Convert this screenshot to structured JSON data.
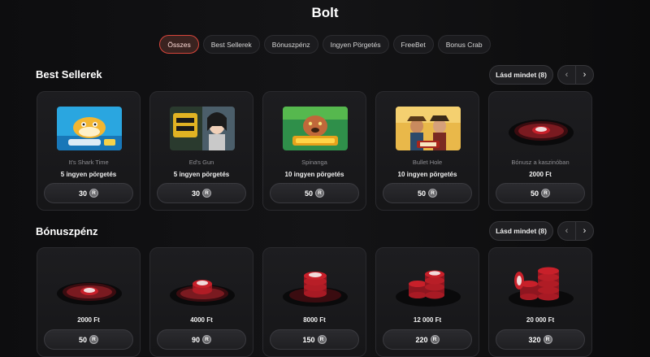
{
  "page": {
    "title": "Bolt"
  },
  "tabs": [
    {
      "label": "Összes",
      "active": true
    },
    {
      "label": "Best Sellerek",
      "active": false
    },
    {
      "label": "Bónuszpénz",
      "active": false
    },
    {
      "label": "Ingyen Pörgetés",
      "active": false
    },
    {
      "label": "FreeBet",
      "active": false
    },
    {
      "label": "Bonus Crab",
      "active": false
    }
  ],
  "sections": [
    {
      "title": "Best Sellerek",
      "see_all": "Lásd mindet (8)",
      "cards": [
        {
          "name": "It's Shark Time",
          "sub": "5 ingyen pörgetés",
          "price": "30",
          "image": "shark-time-game-thumbnail"
        },
        {
          "name": "Ed's Gun",
          "sub": "5 ingyen pörgetés",
          "price": "30",
          "image": "eds-gun-game-thumbnail"
        },
        {
          "name": "Spinanga",
          "sub": "10 ingyen pörgetés",
          "price": "50",
          "image": "spinanga-game-thumbnail"
        },
        {
          "name": "Bullet Hole",
          "sub": "10 ingyen pörgetés",
          "price": "50",
          "image": "bullet-hole-game-thumbnail"
        },
        {
          "name": "Bónusz a kaszinóban",
          "sub": "2000 Ft",
          "price": "50",
          "image": "casino-chip-single"
        }
      ]
    },
    {
      "title": "Bónuszpénz",
      "see_all": "Lásd mindet (8)",
      "cards": [
        {
          "sub": "2000 Ft",
          "price": "50",
          "image": "casino-chip-single"
        },
        {
          "sub": "4000 Ft",
          "price": "90",
          "image": "casino-chip-double"
        },
        {
          "sub": "8000 Ft",
          "price": "150",
          "image": "casino-chip-stack"
        },
        {
          "sub": "12 000 Ft",
          "price": "220",
          "image": "casino-chip-stack-large"
        },
        {
          "sub": "20 000 Ft",
          "price": "320",
          "image": "casino-chip-tower"
        }
      ]
    }
  ],
  "coin": {
    "glyph": "R"
  },
  "nav": {
    "prev": "‹",
    "next": "›"
  },
  "colors": {
    "accent": "#d8453b",
    "chip_red": "#c8202a",
    "background": "#111113"
  }
}
